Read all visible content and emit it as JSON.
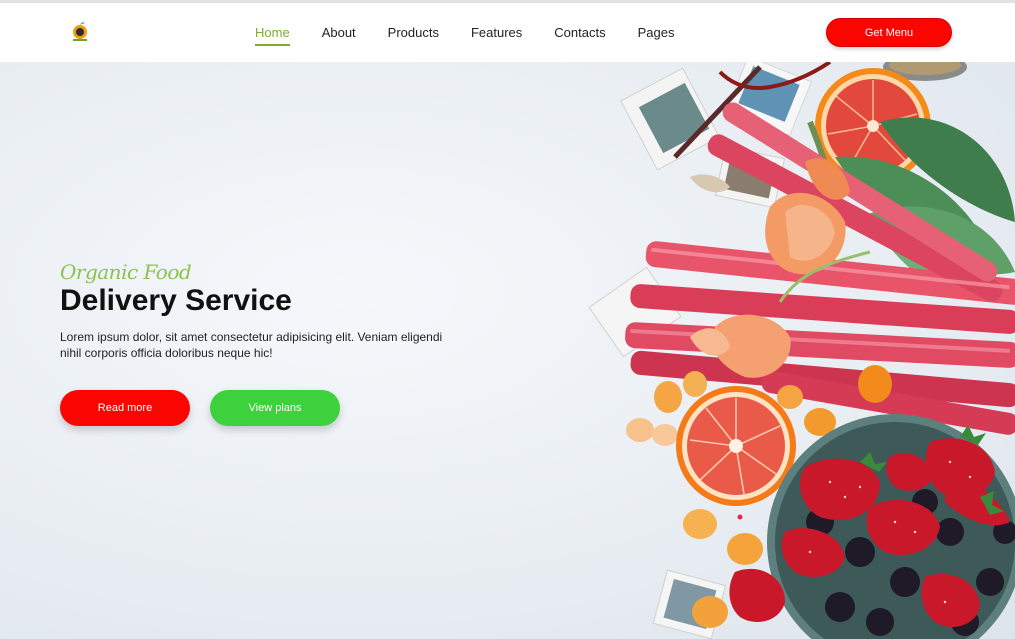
{
  "header": {
    "logo_icon": "orange-fruit-logo-icon",
    "nav": [
      {
        "label": "Home",
        "active": true
      },
      {
        "label": "About",
        "active": false
      },
      {
        "label": "Products",
        "active": false
      },
      {
        "label": "Features",
        "active": false
      },
      {
        "label": "Contacts",
        "active": false
      },
      {
        "label": "Pages",
        "active": false
      }
    ],
    "cta_label": "Get Menu"
  },
  "hero": {
    "eyebrow": "Organic Food",
    "headline": "Delivery Service",
    "description": "Lorem ipsum dolor, sit amet consectetur adipisicing elit. Veniam eligendi nihil corporis officia doloribus neque hic!",
    "read_more_label": "Read more",
    "view_plans_label": "View plans",
    "image": "fresh-fruit-and-rhubarb-flatlay"
  },
  "colors": {
    "accent_green": "#7bb02f",
    "eyebrow_green": "#8bc34a",
    "primary_red": "#fa0500",
    "secondary_green": "#3dd13d"
  }
}
